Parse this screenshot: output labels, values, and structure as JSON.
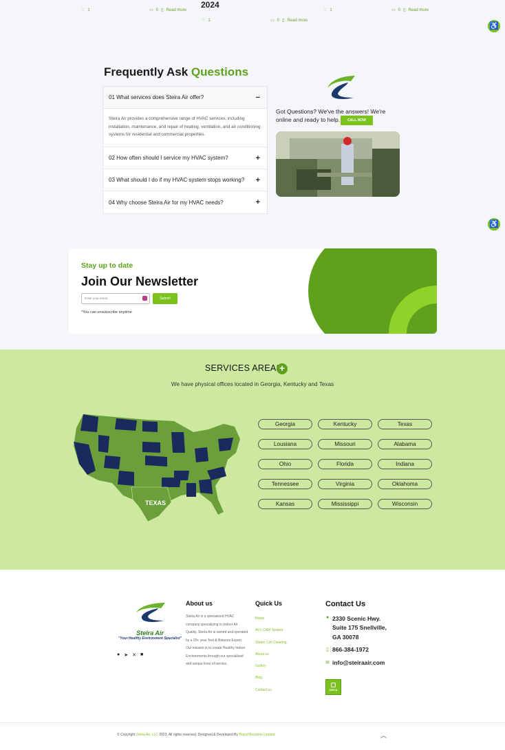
{
  "top": {
    "year": "2024",
    "posts": [
      {
        "likes": "1",
        "comments": "0",
        "read_more": "Read more"
      },
      {
        "likes": "1",
        "comments": "0",
        "read_more": "Read more"
      },
      {
        "likes": "1",
        "comments": "0",
        "read_more": "Read more"
      }
    ]
  },
  "faq": {
    "title_main": "Frequently Ask ",
    "title_accent": "Questions",
    "items": [
      {
        "q": "01 What services does Steira Air offer?",
        "icon": "−",
        "answer": "Steira Air provides a comprehensive range of HVAC services, including installation, maintenance, and repair of heating, ventilation, and air conditioning systems for residential and commercial properties."
      },
      {
        "q": "02 How often should I service my HVAC system?",
        "icon": "+"
      },
      {
        "q": "03 What should I do if my HVAC system stops working?",
        "icon": "+"
      },
      {
        "q": "04 Why choose Steira Air for my HVAC needs?",
        "icon": "+"
      }
    ],
    "cta_text": "Got Questions? We've the answers! We're online and ready to help.",
    "cta_button": "CALL NOW"
  },
  "newsletter": {
    "subtitle": "Stay up to date",
    "title": "Join Our Newsletter",
    "placeholder": "Enter your email...",
    "submit": "Submit",
    "note": "*You can unsubscribe anytime"
  },
  "areas": {
    "title": "SERVICES AREAS",
    "plus": "+",
    "subtitle": "We have physical offices located in Georgia, Kentucky and Texas",
    "map_label": "TEXAS",
    "states": [
      "Georgia",
      "Kentucky",
      "Texas",
      "Lousiana",
      "Missouri",
      "Alabama",
      "Ohio",
      "Florida",
      "Indiana",
      "Tennessee",
      "Virginia",
      "Oklahoma",
      "Kansas",
      "Mississippi",
      "Wisconsin"
    ]
  },
  "footer": {
    "logo_name": "Steira Air",
    "logo_tagline": "\"Your Healthy Environment Specialist\"",
    "about_title": "About us",
    "about_text": "Steira Air is a specialized HVAC company specializing in Indoor Air Quality. Steira Air is owned and operated by a 20+ year Test & Balance Expert. Our mission is to create Healthy Indoor Environments through our specialized and unique lines of service.",
    "quick_title": "Quick Us",
    "quick_links": [
      "Home",
      "Air's CAM System",
      "Steam Coil Cleaning",
      "About us",
      "Gallery",
      "Blog",
      "Contact us"
    ],
    "contact_title": "Contact Us",
    "address_lines": [
      "2330 Scenic Hwy.",
      "Suite 175 Snellville,",
      "GA 30078"
    ],
    "phone": "866-384-1972",
    "email": "info@steiraair.com",
    "badge_text": "DMCA",
    "copyright_pre": "© Copyright ",
    "copyright_company": "Steira Air, LLC",
    "copyright_mid": " 2023. All rights reserved. Designed & Developed By ",
    "copyright_dev": "Brand Boosters Limited"
  },
  "colors": {
    "accent": "#7cc21e",
    "dark_accent": "#5fa11c",
    "navy": "#1b2a5c",
    "areas_bg": "#cde9a0"
  }
}
